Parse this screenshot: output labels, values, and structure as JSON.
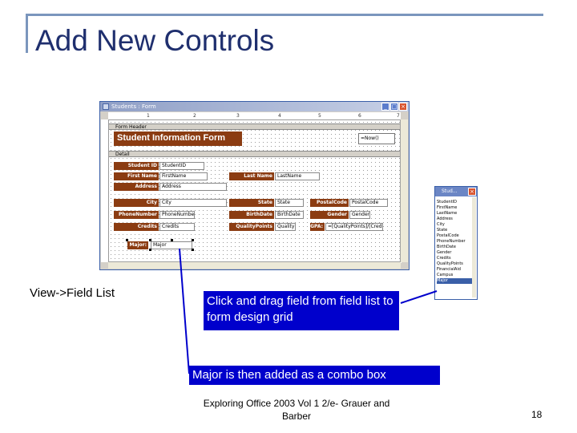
{
  "slide": {
    "title": "Add New Controls",
    "caption_left": "View->Field List",
    "callout_drag": "Click and drag field from field list to form design grid",
    "callout_combo": "Major is then added as a combo box",
    "footer": "Exploring Office 2003 Vol 1 2/e- Grauer and Barber",
    "page_number": "18"
  },
  "form_window": {
    "title": "Students : Form",
    "ruler_numbers": [
      "1",
      "2",
      "3",
      "4",
      "5",
      "6",
      "7"
    ],
    "sections": {
      "header": "Form Header",
      "detail": "Detail"
    },
    "header_label": "Student Information Form",
    "header_field": "=Now()",
    "controls": [
      {
        "label": "Student ID",
        "field": "StudentID"
      },
      {
        "label": "First Name",
        "field": "FirstName"
      },
      {
        "label": "Last Name",
        "field": "LastName"
      },
      {
        "label": "Address",
        "field": "Address"
      },
      {
        "label": "City",
        "field": "City"
      },
      {
        "label": "State",
        "field": "State"
      },
      {
        "label": "PostalCode",
        "field": "PostalCode"
      },
      {
        "label": "PhoneNumber",
        "field": "PhoneNumber"
      },
      {
        "label": "BirthDate",
        "field": "BirthDate"
      },
      {
        "label": "Gender",
        "field": "Gender"
      },
      {
        "label": "Credits",
        "field": "Credits"
      },
      {
        "label": "QualityPoints",
        "field": "QualityPoints"
      },
      {
        "label": "GPA:",
        "field": "=[QualityPoints]/[Credits]"
      },
      {
        "label": "Major:",
        "field": "Major"
      }
    ]
  },
  "field_list": {
    "title": "Stud...",
    "items": [
      "StudentID",
      "FirstName",
      "LastName",
      "Address",
      "City",
      "State",
      "PostalCode",
      "PhoneNumber",
      "BirthDate",
      "Gender",
      "Credits",
      "QualityPoints",
      "FinancialAid",
      "Campus",
      "Major"
    ],
    "selected": "Major"
  },
  "colors": {
    "title": "#1f2f6e",
    "label_fill": "#8b3c12",
    "callout_fill": "#0000cc",
    "accent_line": "#7b96bd"
  }
}
